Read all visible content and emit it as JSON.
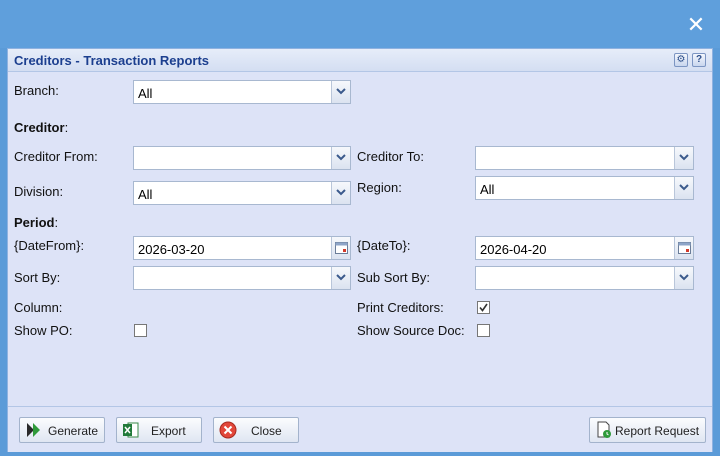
{
  "window": {
    "close_label": "✕"
  },
  "panel": {
    "title": "Creditors - Transaction Reports",
    "gear_label": "⚙",
    "help_label": "?"
  },
  "form": {
    "branch_label": "Branch:",
    "branch_value": "All",
    "creditor_section": "Creditor",
    "creditor_from_label": "Creditor From:",
    "creditor_from_value": "",
    "creditor_to_label": "Creditor To:",
    "creditor_to_value": "",
    "division_label": "Division:",
    "division_value": "All",
    "region_label": "Region:",
    "region_value": "All",
    "period_section": "Period",
    "date_from_label": "{DateFrom}:",
    "date_from_value": "2026-03-20",
    "date_to_label": "{DateTo}:",
    "date_to_value": "2026-04-20",
    "sort_by_label": "Sort By:",
    "sort_by_value": "",
    "sub_sort_by_label": "Sub Sort By:",
    "sub_sort_by_value": "",
    "column_label": "Column:",
    "print_creditors_label": "Print Creditors:",
    "print_creditors_checked": true,
    "show_po_label": "Show PO:",
    "show_po_checked": false,
    "show_source_doc_label": "Show Source Doc:",
    "show_source_doc_checked": false
  },
  "footer": {
    "generate_label": "Generate",
    "export_label": "Export",
    "close_label": "Close",
    "report_request_label": "Report Request"
  }
}
